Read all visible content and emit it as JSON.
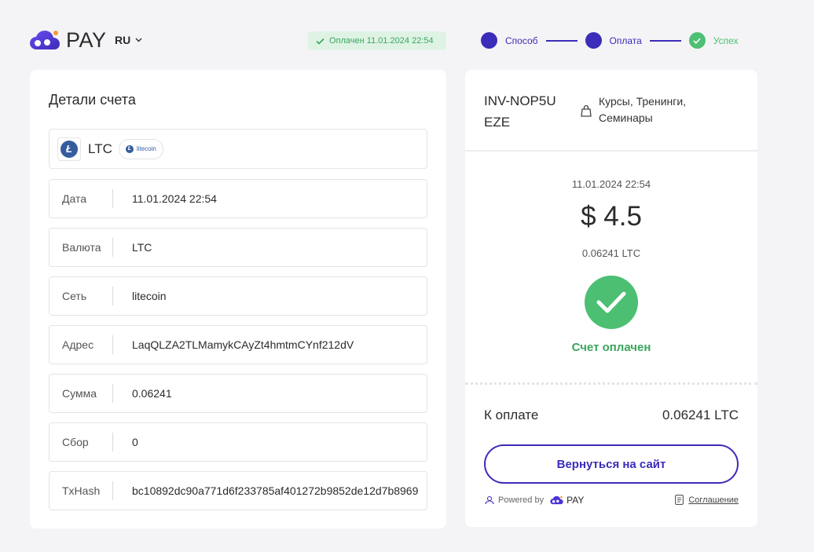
{
  "header": {
    "brand": "PAY",
    "language": "RU",
    "status_badge": "Оплачен 11.01.2024 22:54",
    "steps": [
      {
        "label": "Способ",
        "state": "active"
      },
      {
        "label": "Оплата",
        "state": "active"
      },
      {
        "label": "Успех",
        "state": "done"
      }
    ]
  },
  "details": {
    "title": "Детали счета",
    "coin": {
      "symbol": "LTC",
      "network_badge": "litecoin",
      "icon": "litecoin-icon"
    },
    "rows": [
      {
        "key": "Дата",
        "value": "11.01.2024 22:54"
      },
      {
        "key": "Валюта",
        "value": "LTC"
      },
      {
        "key": "Сеть",
        "value": "litecoin"
      },
      {
        "key": "Адрес",
        "value": "LaqQLZA2TLMamykCAyZt4hmtmCYnf212dV"
      },
      {
        "key": "Сумма",
        "value": "0.06241"
      },
      {
        "key": "Сбор",
        "value": "0"
      },
      {
        "key": "TxHash",
        "value": "bc10892dc90a771d6f233785af401272b9852de12d7b8969"
      }
    ]
  },
  "invoice": {
    "id": "INV-NOP5UEZE",
    "category": "Курсы, Тренинги, Семинары",
    "date": "11.01.2024 22:54",
    "amount_usd": "$ 4.5",
    "amount_crypto": "0.06241 LTC",
    "status_text": "Счет оплачен",
    "due_label": "К оплате",
    "due_value": "0.06241 LTC",
    "back_button": "Вернуться на сайт",
    "powered_by": "Powered by",
    "powered_brand": "PAY",
    "agreement": "Соглашение"
  },
  "colors": {
    "accent": "#3b2cb9",
    "success": "#4cbf73",
    "background": "#f4f4f6"
  }
}
